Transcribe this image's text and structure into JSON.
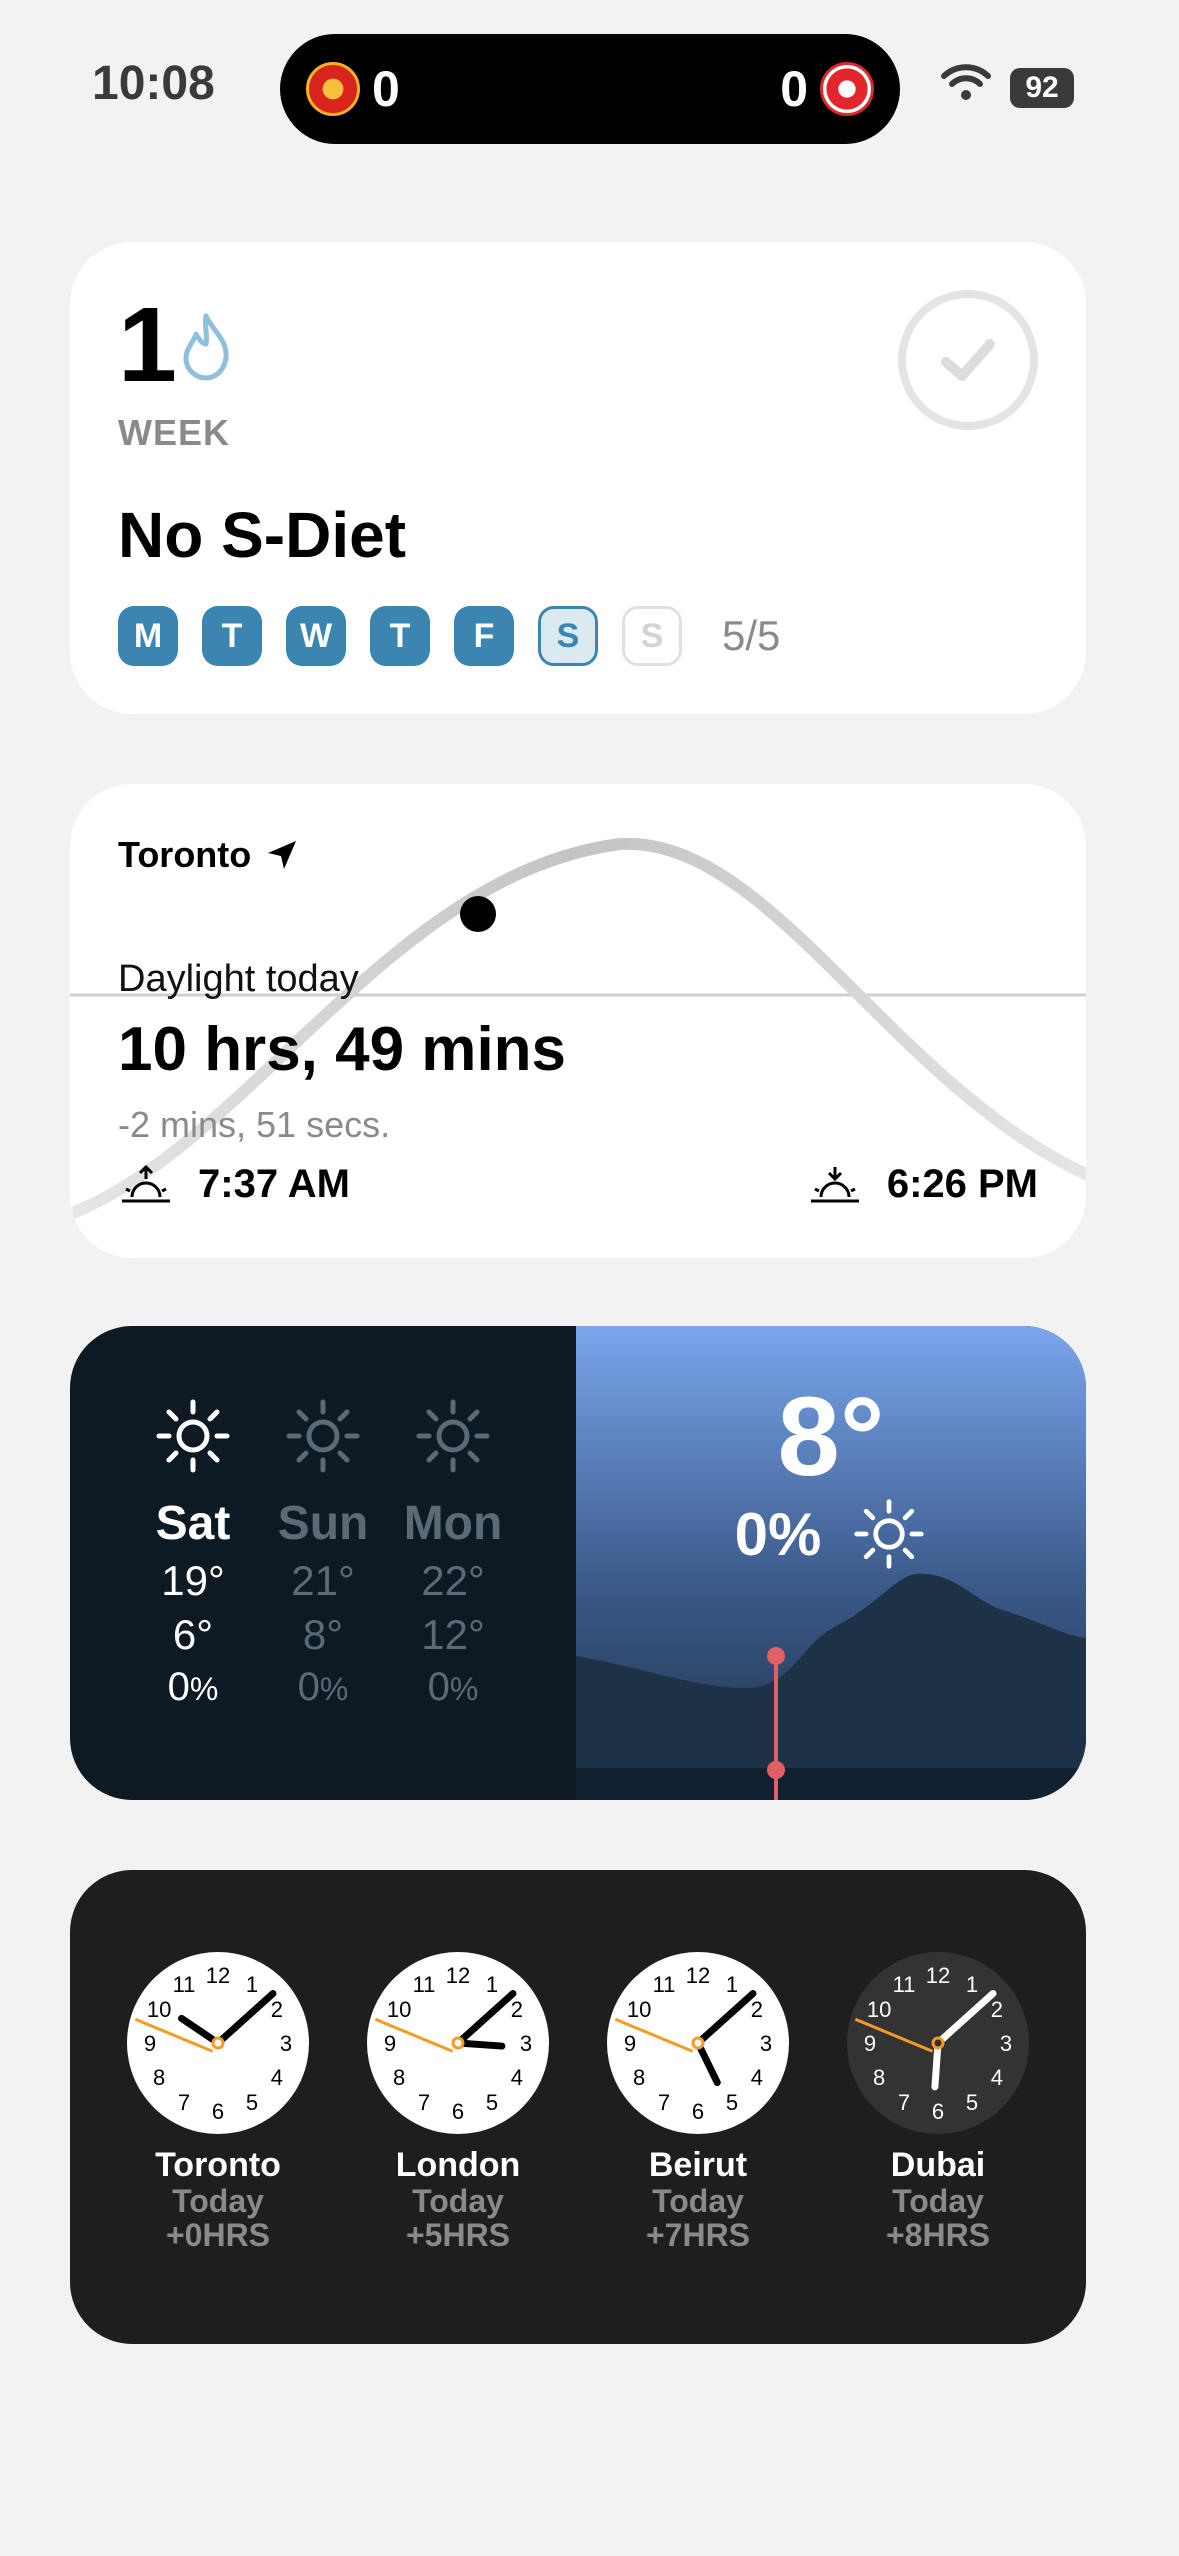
{
  "status_bar": {
    "time": "10:08",
    "live_activity": {
      "home_score": "0",
      "away_score": "0"
    },
    "battery": "92"
  },
  "habit_widget": {
    "streak_count": "1",
    "streak_unit": "WEEK",
    "name": "No S-Diet",
    "days": [
      {
        "label": "M",
        "state": "done"
      },
      {
        "label": "T",
        "state": "done"
      },
      {
        "label": "W",
        "state": "done"
      },
      {
        "label": "T",
        "state": "done"
      },
      {
        "label": "F",
        "state": "done"
      },
      {
        "label": "S",
        "state": "partial"
      },
      {
        "label": "S",
        "state": "empty"
      }
    ],
    "progress": "5/5",
    "accent_color": "#3a86b0"
  },
  "daylight_widget": {
    "city": "Toronto",
    "label": "Daylight today",
    "duration": "10 hrs, 49 mins",
    "change": "-2 mins, 51 secs.",
    "sunrise": "7:37 AM",
    "sunset": "6:26 PM"
  },
  "weather_widget": {
    "forecast": [
      {
        "day": "Sat",
        "high": "19°",
        "low": "6°",
        "rain_value": "0",
        "rain_unit": "%"
      },
      {
        "day": "Sun",
        "high": "21°",
        "low": "8°",
        "rain_value": "0",
        "rain_unit": "%"
      },
      {
        "day": "Mon",
        "high": "22°",
        "low": "12°",
        "rain_value": "0",
        "rain_unit": "%"
      }
    ],
    "current_temp": "8°",
    "current_rain": "0%"
  },
  "world_clock_widget": {
    "clocks": [
      {
        "city": "Toronto",
        "day": "Today",
        "offset": "+0HRS",
        "theme": "light"
      },
      {
        "city": "London",
        "day": "Today",
        "offset": "+5HRS",
        "theme": "light"
      },
      {
        "city": "Beirut",
        "day": "Today",
        "offset": "+7HRS",
        "theme": "light"
      },
      {
        "city": "Dubai",
        "day": "Today",
        "offset": "+8HRS",
        "theme": "dark"
      }
    ]
  }
}
